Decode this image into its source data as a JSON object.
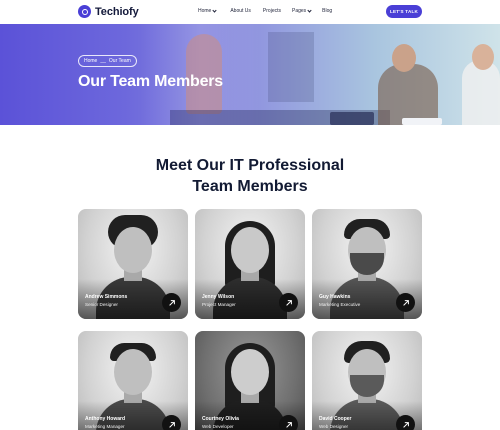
{
  "header": {
    "logo_text": "Techiofy",
    "nav": [
      {
        "label": "Home",
        "has_caret": true
      },
      {
        "label": "About Us",
        "has_caret": false
      },
      {
        "label": "Projects",
        "has_caret": false
      },
      {
        "label": "Pages",
        "has_caret": true
      },
      {
        "label": "Blog",
        "has_caret": false
      }
    ],
    "cta_label": "LET'S TALK"
  },
  "hero": {
    "breadcrumb": {
      "home": "Home",
      "separator": "__",
      "current": "Our Team"
    },
    "title": "Our Team Members"
  },
  "section": {
    "title_line1": "Meet Our IT Professional",
    "title_line2": "Team Members"
  },
  "team": [
    {
      "name": "Andrew Simmons",
      "role": "Senior Designer"
    },
    {
      "name": "Jenny Wilson",
      "role": "Project Manager"
    },
    {
      "name": "Guy Hawkins",
      "role": "Marketing Executive"
    },
    {
      "name": "Anthony Howard",
      "role": "Marketing Manager"
    },
    {
      "name": "Courtney Olivia",
      "role": "Web Developer"
    },
    {
      "name": "David Cooper",
      "role": "Web Designer"
    }
  ],
  "icons": {
    "logo": "logo-ring-icon",
    "card_action": "arrow-up-right-icon",
    "nav_caret": "chevron-down-icon"
  },
  "colors": {
    "brand": "#4a3fd6",
    "heading": "#121a33"
  }
}
